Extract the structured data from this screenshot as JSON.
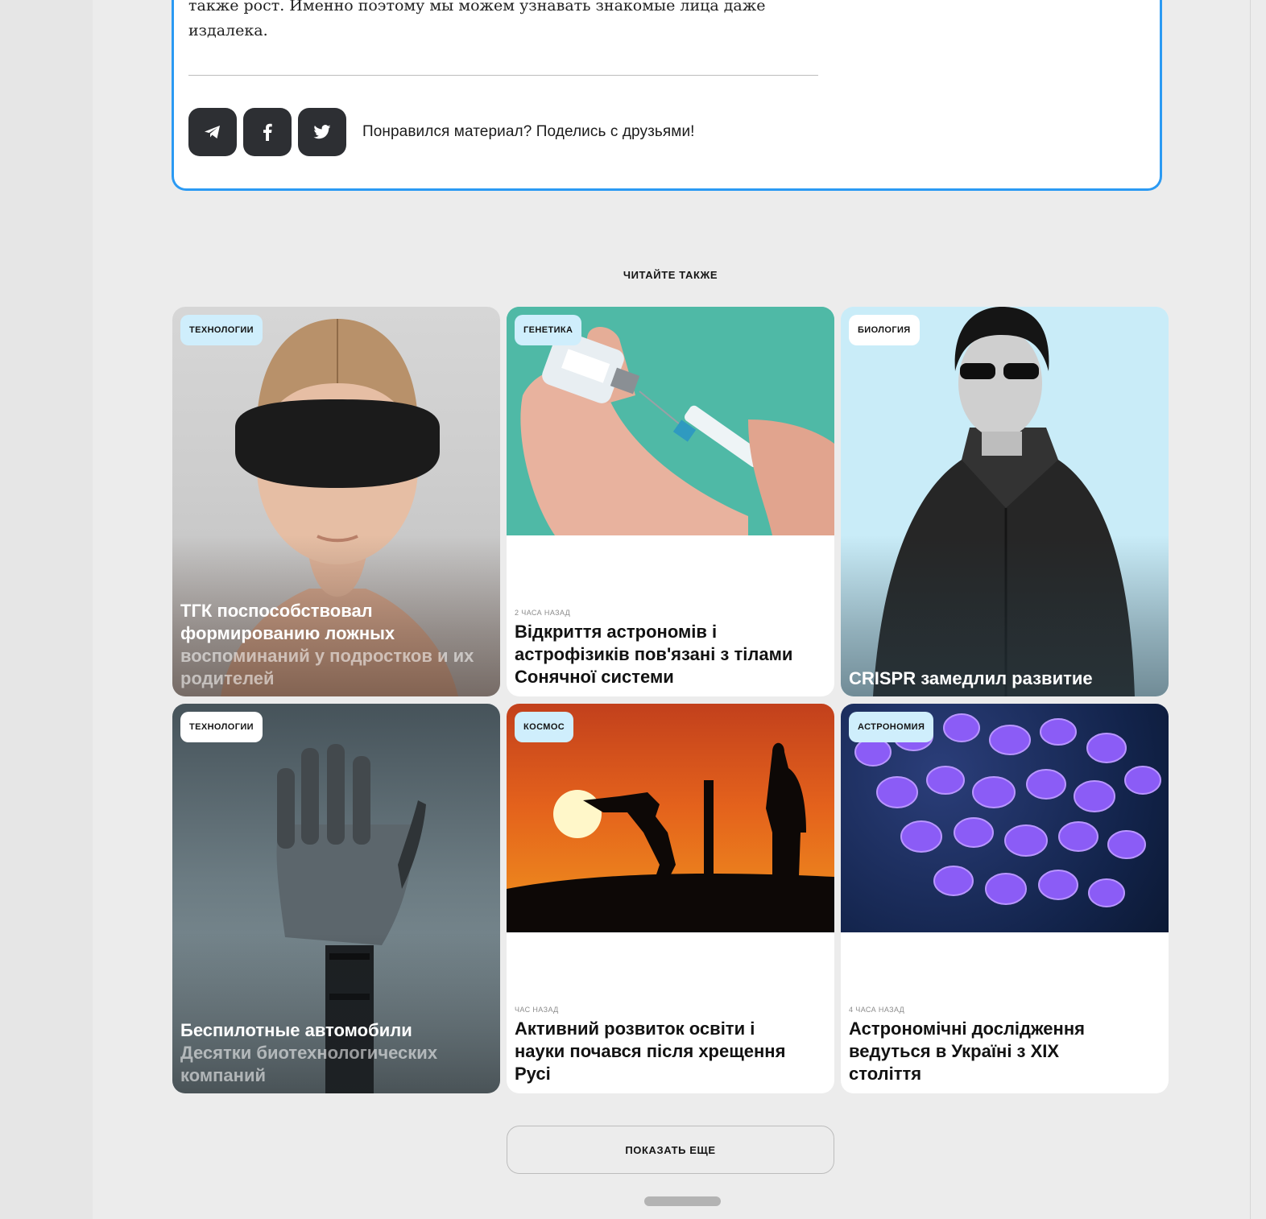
{
  "article": {
    "text_line1": "также рост. Именно поэтому мы можем узнавать знакомые лица даже",
    "text_line2": "издалека.",
    "share_prompt": "Понравился материал? Поделись с друзьями!",
    "share_buttons": [
      {
        "icon": "telegram-icon"
      },
      {
        "icon": "facebook-icon"
      },
      {
        "icon": "twitter-icon"
      }
    ]
  },
  "related": {
    "section_title": "ЧИТАЙТЕ ТАКЖЕ",
    "cards": [
      {
        "tag": "ТЕХНОЛОГИИ",
        "title": "ТГК поспособствовал формированию ложных",
        "subtitle": "воспоминаний у подростков и их родителей",
        "image": "woman-with-vr-visor"
      },
      {
        "tag": "ГЕНЕТИКА",
        "time": "2 ЧАСА НАЗАД",
        "title": "Відкриття астрономів і астрофізиків пов'язані з тілами Сонячної системи",
        "image": "hand-with-syringe-and-vial"
      },
      {
        "tag": "БИОЛОГИЯ",
        "title": "CRISPR замедлил развитие",
        "image": "man-in-black-coat-sunglasses"
      },
      {
        "tag": "ТЕХНОЛОГИИ",
        "title": "Беспилотные автомобили",
        "subtitle": "Десятки биотехнологических компаний",
        "image": "robotic-hand"
      },
      {
        "tag": "КОСМОС",
        "time": "ЧАС НАЗАД",
        "title": "Активний розвиток освіти і науки почався після хрещення Русі",
        "image": "robot-silhouette-sunset"
      },
      {
        "tag": "АСТРОНОМИЯ",
        "time": "4 ЧАСА НАЗАД",
        "title": "Астрономічні дослідження ведуться в Україні з XIX століття",
        "image": "purple-cells-microscopy"
      }
    ],
    "show_more_label": "ПОКАЗАТЬ ЕЩЕ"
  },
  "colors": {
    "accent_border": "#2b9af3",
    "tag_blue": "#cfeefc",
    "share_button": "#2d2f33"
  }
}
